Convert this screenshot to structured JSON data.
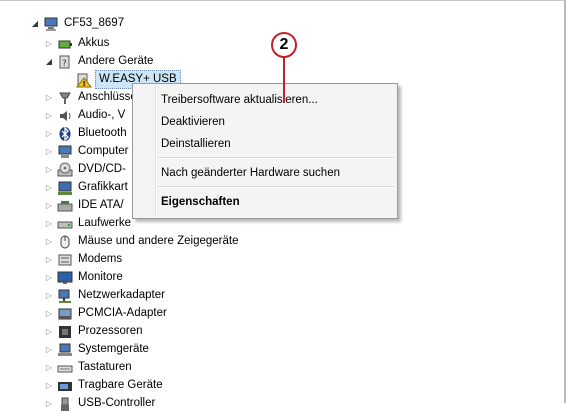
{
  "tree": {
    "root": "CF53_8697",
    "items": [
      {
        "label": "Akkus"
      },
      {
        "label": "Andere Geräte"
      },
      {
        "label": "W.EASY+ USB"
      },
      {
        "label": "Anschlüsse"
      },
      {
        "label": "Audio-, V"
      },
      {
        "label": "Bluetooth"
      },
      {
        "label": "Computer"
      },
      {
        "label": "DVD/CD-"
      },
      {
        "label": "Grafikkart"
      },
      {
        "label": "IDE ATA/"
      },
      {
        "label": "Laufwerke"
      },
      {
        "label": "Mäuse und andere Zeigegeräte"
      },
      {
        "label": "Modems"
      },
      {
        "label": "Monitore"
      },
      {
        "label": "Netzwerkadapter"
      },
      {
        "label": "PCMCIA-Adapter"
      },
      {
        "label": "Prozessoren"
      },
      {
        "label": "Systemgeräte"
      },
      {
        "label": "Tastaturen"
      },
      {
        "label": "Tragbare Geräte"
      },
      {
        "label": "USB-Controller"
      }
    ]
  },
  "context_menu": {
    "items": [
      {
        "label": "Treibersoftware aktualisieren..."
      },
      {
        "label": "Deaktivieren"
      },
      {
        "label": "Deinstallieren"
      },
      {
        "label": "Nach geänderter Hardware suchen"
      },
      {
        "label": "Eigenschaften"
      }
    ]
  },
  "callout": {
    "number": "2",
    "color": "#c0222c"
  },
  "colors": {
    "selection": "#cde6f7",
    "menu_bg": "#f4f4f4"
  }
}
